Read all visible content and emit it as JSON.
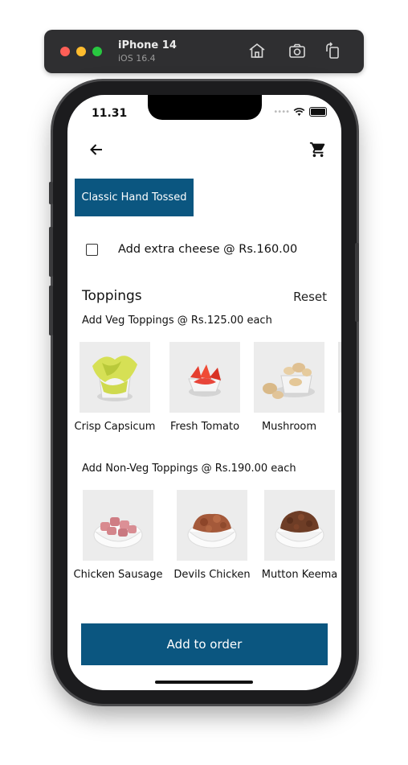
{
  "simulator": {
    "device_name": "iPhone 14",
    "os_version": "iOS 16.4",
    "icons": [
      "home-icon",
      "screenshot-icon",
      "rotate-icon"
    ]
  },
  "status_bar": {
    "time": "11.31"
  },
  "header": {
    "back_icon": "arrow-left-icon",
    "cart_icon": "cart-icon"
  },
  "crust": {
    "label": "Classic Hand Tossed"
  },
  "extra_cheese": {
    "label": "Add extra cheese @ Rs.160.00",
    "checked": false
  },
  "toppings": {
    "title": "Toppings",
    "reset_label": "Reset",
    "veg_heading": "Add Veg Toppings @ Rs.125.00 each",
    "veg_items": [
      {
        "label": "Crisp Capsicum"
      },
      {
        "label": "Fresh Tomato"
      },
      {
        "label": "Mushroom"
      }
    ],
    "nonveg_heading": "Add Non-Veg Toppings @ Rs.190.00 each",
    "nonveg_items": [
      {
        "label": "Chicken Sausage"
      },
      {
        "label": "Devils Chicken"
      },
      {
        "label": "Mutton Keema"
      }
    ]
  },
  "footer": {
    "add_button_label": "Add to order"
  },
  "colors": {
    "primary": "#0b5680",
    "background": "#ffffff",
    "text": "#111111"
  }
}
